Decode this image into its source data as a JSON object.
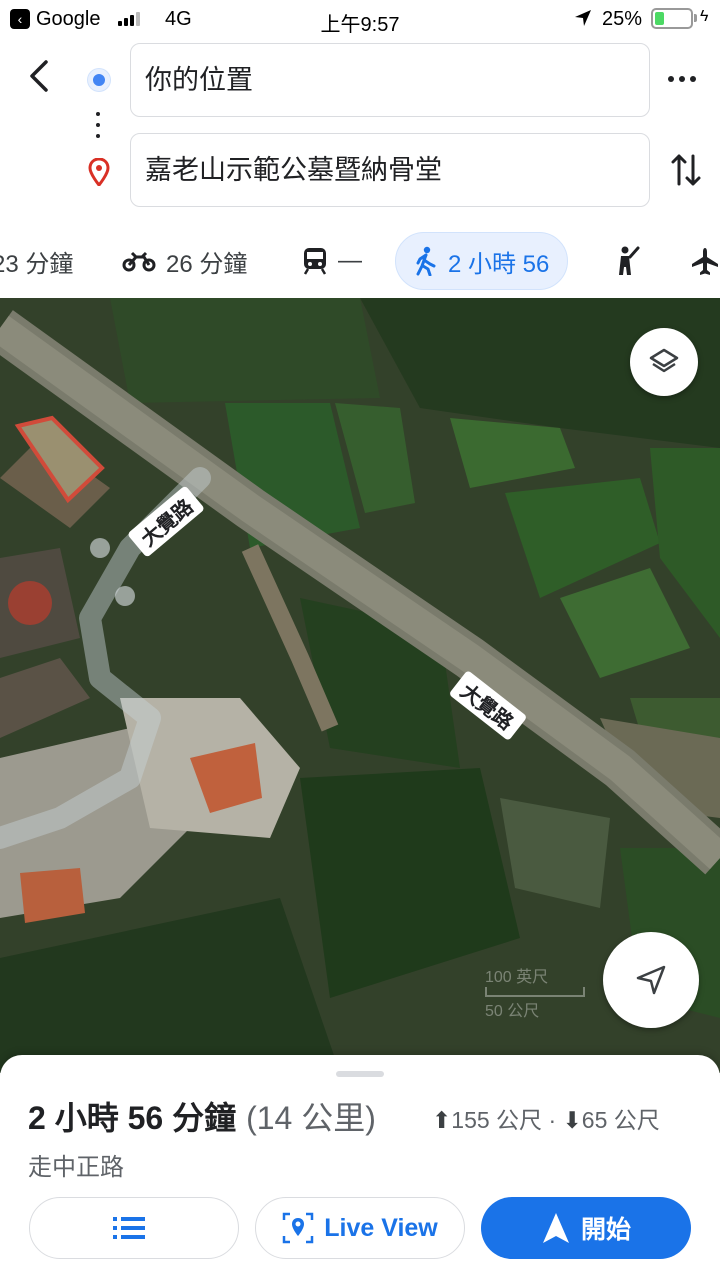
{
  "status_bar": {
    "back_app": "Google",
    "network": "4G",
    "time": "上午9:57",
    "battery_pct": "25%",
    "battery_level": 0.25
  },
  "search": {
    "origin": "你的位置",
    "destination": "嘉老山示範公墓暨納骨堂"
  },
  "modes": [
    {
      "icon": "car-icon",
      "label": "23 分鐘"
    },
    {
      "icon": "motorcycle-icon",
      "label": "26 分鐘"
    },
    {
      "icon": "transit-icon",
      "label": "—"
    },
    {
      "icon": "walk-icon",
      "label": "2 小時 56",
      "selected": true
    },
    {
      "icon": "rideshare-icon",
      "label": ""
    },
    {
      "icon": "flight-icon",
      "label": ""
    }
  ],
  "map": {
    "road_labels": [
      "大覺路",
      "大覺路"
    ],
    "scale_label": "100 英尺",
    "scale_label_2": "50 公尺"
  },
  "sheet": {
    "duration": "2 小時 56 分鐘",
    "distance": "(14 公里)",
    "ascent": "155 公尺",
    "separator": "·",
    "descent": "65 公尺",
    "via": "走中正路",
    "live_view_label": "Live View",
    "start_label": "開始"
  }
}
